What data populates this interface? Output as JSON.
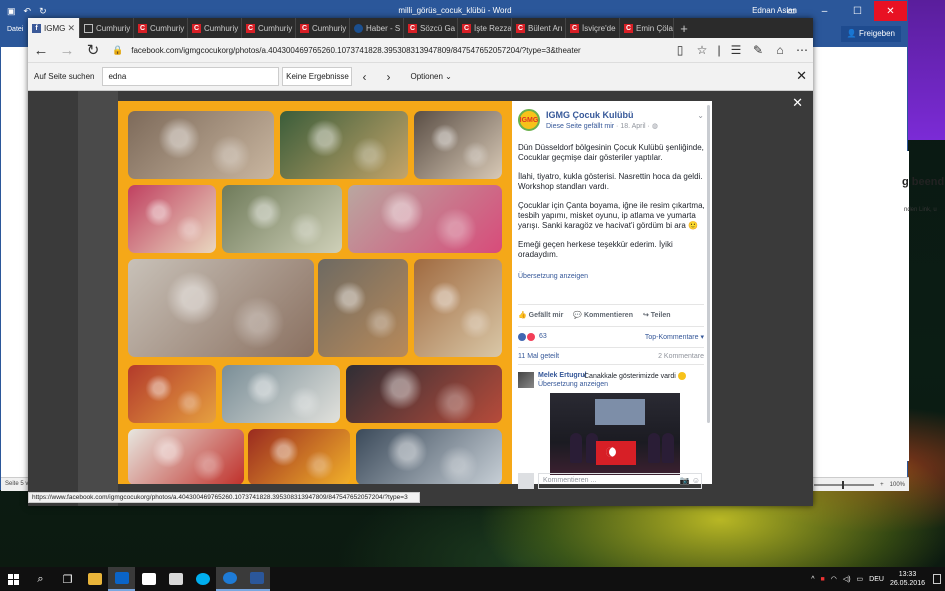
{
  "word": {
    "title": "milli_görüs_cocuk_klübü - Word",
    "user": "Ednan Aslan",
    "share": "Freigeben",
    "ribbon_left": "Datei",
    "heading": "g beend",
    "side_text": "nden Link, u",
    "status_left": "Seite 5 v",
    "zoom": "100%"
  },
  "browser": {
    "tabs": [
      {
        "label": "IGMG",
        "favicon": "fb",
        "active": true
      },
      {
        "label": "Cumhuriy",
        "favicon": "doc"
      },
      {
        "label": "Cumhuriy",
        "favicon": "red"
      },
      {
        "label": "Cumhuriy",
        "favicon": "red"
      },
      {
        "label": "Cumhuriy",
        "favicon": "red"
      },
      {
        "label": "Cumhuriy",
        "favicon": "red"
      },
      {
        "label": "Haber - S",
        "favicon": "haber"
      },
      {
        "label": "Sözcü Ga",
        "favicon": "red"
      },
      {
        "label": "İşte Rezza",
        "favicon": "red"
      },
      {
        "label": "Bülent Arı",
        "favicon": "red"
      },
      {
        "label": "İsviçre'de",
        "favicon": "red"
      },
      {
        "label": "Emin Çöla",
        "favicon": "red"
      }
    ],
    "new_tab": "+",
    "url": "facebook.com/igmgcocukorg/photos/a.404300469765260.1073741828.395308313947809/847547652057204/?type=3&theater",
    "find": {
      "label": "Auf Seite suchen",
      "query": "edna",
      "result": "Keine Ergebnisse",
      "options": "Optionen"
    },
    "status_url": "https://www.facebook.com/igmgcocukorg/photos/a.404300469765260.1073741828.395308313947809/847547652057204/?type=3"
  },
  "post": {
    "page_name": "IGMG Çocuk Kulübü",
    "liked": "Diese Seite gefällt mir",
    "date": "· 18. April ·",
    "paragraphs": [
      "Dün Düsseldorf bölgesinin Çocuk Kulübü şenliğinde, Cocuklar geçmişe dair gösteriler yaptılar.",
      "İlahi, tiyatro, kukla gösterisi. Nasrettin hoca da geldi. Workshop standları vardı.",
      "Çocuklar için Çanta boyama, iğne ile resim çıkartma, tesbih yapımı, misket oyunu, ip atlama ve yumarta yarışı. Sanki karagöz ve hacivat'i gördüm bi ara 🙂",
      "Emeği geçen herkese teşekkür ederim. İyiki oradaydım."
    ],
    "translate": "Übersetzung anzeigen",
    "actions": [
      "Gefällt mir",
      "Kommentieren",
      "Teilen"
    ],
    "reaction_count": "63",
    "top_comments": "Top-Kommentare ▾",
    "shares": "11 Mal geteilt",
    "comments_count": "2 Kommentare",
    "comment": {
      "author": "Melek Ertugrul",
      "text": "Canakkale gösterimizde vardi",
      "translate": "Übersetzung anzeigen"
    },
    "write_placeholder": "Kommentieren ..."
  },
  "taskbar": {
    "time": "13:33",
    "date": "26.05.2016",
    "lang": "DEU"
  },
  "colors": {
    "photo_bg": "#f5a818",
    "fb_blue": "#365899",
    "word_blue": "#2b579a"
  }
}
